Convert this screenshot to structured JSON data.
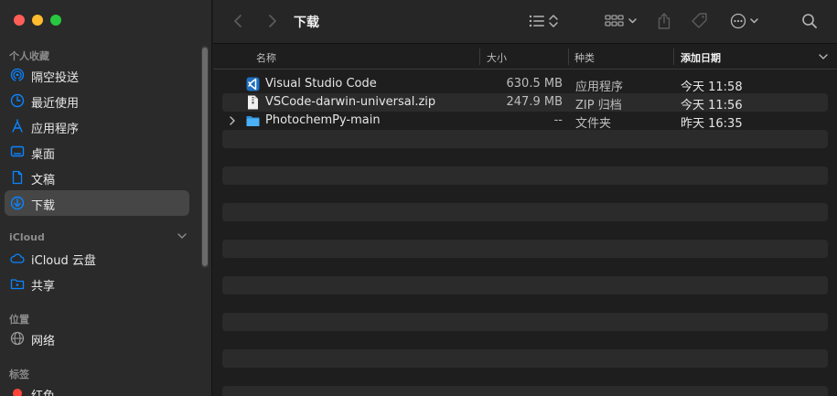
{
  "window": {
    "title": "下载"
  },
  "sidebar": {
    "favorites_header": "个人收藏",
    "favorites": [
      {
        "label": "隔空投送",
        "icon": "airdrop-icon"
      },
      {
        "label": "最近使用",
        "icon": "clock-icon"
      },
      {
        "label": "应用程序",
        "icon": "applications-icon"
      },
      {
        "label": "桌面",
        "icon": "desktop-icon"
      },
      {
        "label": "文稿",
        "icon": "document-icon"
      },
      {
        "label": "下载",
        "icon": "download-icon",
        "selected": true
      }
    ],
    "icloud_header": "iCloud",
    "icloud": [
      {
        "label": "iCloud 云盘",
        "icon": "cloud-icon"
      },
      {
        "label": "共享",
        "icon": "shared-folder-icon"
      }
    ],
    "locations_header": "位置",
    "locations": [
      {
        "label": "网络",
        "icon": "network-icon"
      }
    ],
    "tags_header": "标签",
    "tags": [
      {
        "label": "红色",
        "color": "#ff453a"
      }
    ]
  },
  "columns": {
    "name": "名称",
    "size": "大小",
    "kind": "种类",
    "date_added": "添加日期"
  },
  "files": [
    {
      "name": "Visual Studio Code",
      "size": "630.5 MB",
      "kind": "应用程序",
      "date": "今天 11:58",
      "icon": "vscode-app-icon"
    },
    {
      "name": "VSCode-darwin-universal.zip",
      "size": "247.9 MB",
      "kind": "ZIP 归档",
      "date": "今天 11:56",
      "icon": "zip-file-icon"
    },
    {
      "name": "PhotochemPy-main",
      "size": "--",
      "kind": "文件夹",
      "date": "昨天 16:35",
      "icon": "folder-icon",
      "expandable": true
    }
  ],
  "colors": {
    "accent": "#0a84ff",
    "selection": "#464646",
    "vscode_blue": "#2f8fe0",
    "folder_blue": "#3ea8f3"
  }
}
